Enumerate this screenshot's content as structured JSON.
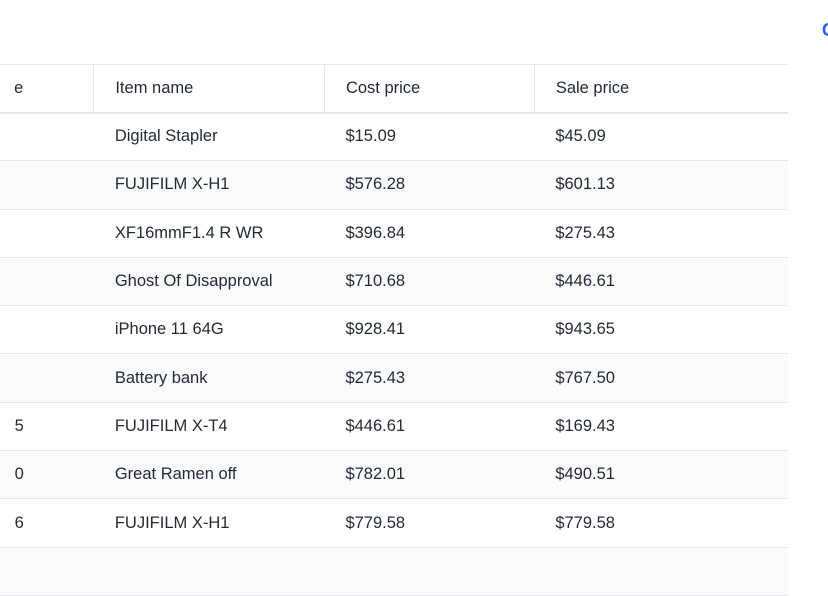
{
  "top_action_label": "C",
  "columns": [
    "e",
    "Item name",
    "Cost price",
    "Sale price"
  ],
  "rows": [
    {
      "c0": "",
      "name": "Digital Stapler",
      "cost": "$15.09",
      "sale": "$45.09"
    },
    {
      "c0": "",
      "name": "FUJIFILM X-H1",
      "cost": "$576.28",
      "sale": "$601.13"
    },
    {
      "c0": "",
      "name": "XF16mmF1.4 R WR",
      "cost": "$396.84",
      "sale": "$275.43"
    },
    {
      "c0": "",
      "name": "Ghost Of Disapproval",
      "cost": "$710.68",
      "sale": "$446.61"
    },
    {
      "c0": "",
      "name": "iPhone 11 64G",
      "cost": "$928.41",
      "sale": "$943.65"
    },
    {
      "c0": "",
      "name": "Battery bank",
      "cost": "$275.43",
      "sale": "$767.50"
    },
    {
      "c0": "5",
      "name": "FUJIFILM X-T4",
      "cost": "$446.61",
      "sale": "$169.43"
    },
    {
      "c0": "0",
      "name": "Great Ramen off",
      "cost": "$782.01",
      "sale": "$490.51"
    },
    {
      "c0": "6",
      "name": "FUJIFILM X-H1",
      "cost": "$779.58",
      "sale": "$779.58"
    },
    {
      "c0": "",
      "name": "",
      "cost": "",
      "sale": ""
    }
  ]
}
